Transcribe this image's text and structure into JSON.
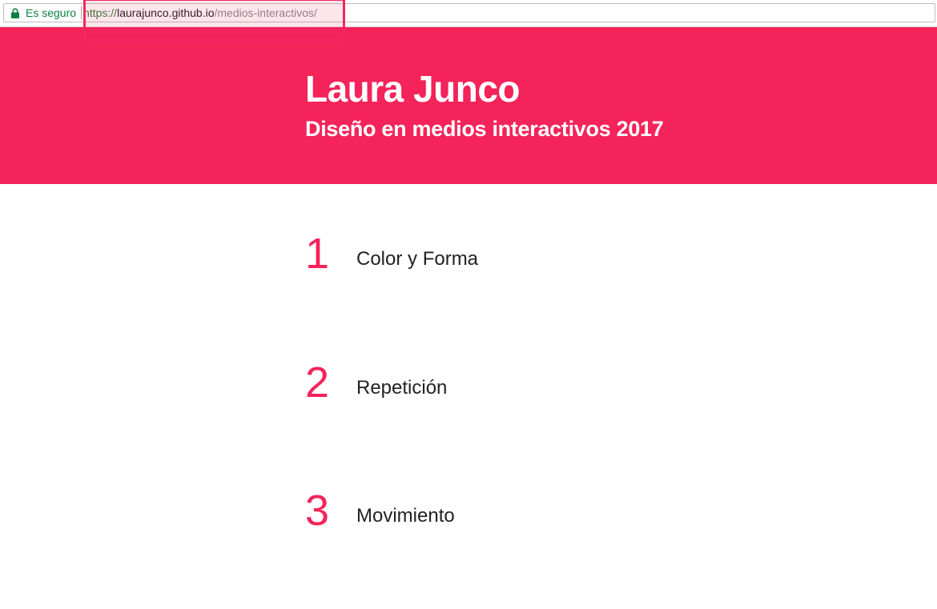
{
  "browser": {
    "secure_label": "Es seguro",
    "url_scheme": "https://",
    "url_host": "laurajunco.github.io",
    "url_path": "/medios-interactivos/"
  },
  "header": {
    "title": "Laura Junco",
    "subtitle": "Diseño en medios interactivos 2017"
  },
  "projects": [
    {
      "number": "1",
      "title": "Color y Forma"
    },
    {
      "number": "2",
      "title": "Repetición"
    },
    {
      "number": "3",
      "title": "Movimiento"
    }
  ],
  "colors": {
    "brand": "#f4235a",
    "secure_green": "#0b8043",
    "highlight": "#f22860"
  },
  "icons": {
    "secure": "lock-icon"
  }
}
